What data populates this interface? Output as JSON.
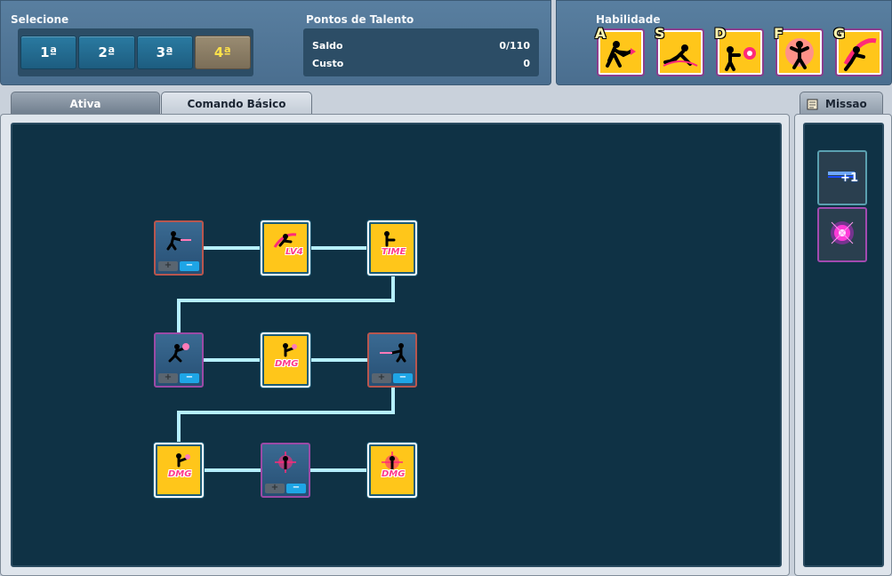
{
  "header": {
    "select_label": "Selecione",
    "select_buttons": [
      {
        "label": "1ª",
        "active": false
      },
      {
        "label": "2ª",
        "active": false
      },
      {
        "label": "3ª",
        "active": false
      },
      {
        "label": "4ª",
        "active": true
      }
    ],
    "talent_title": "Pontos de Talento",
    "saldo_label": "Saldo",
    "saldo_value": "0/110",
    "custo_label": "Custo",
    "custo_value": "0",
    "skills_title": "Habilidade",
    "skills": [
      {
        "key": "A",
        "icon": "kick-skill-icon"
      },
      {
        "key": "S",
        "icon": "slide-skill-icon"
      },
      {
        "key": "D",
        "icon": "energy-blast-skill-icon"
      },
      {
        "key": "F",
        "icon": "burst-skill-icon"
      },
      {
        "key": "G",
        "icon": "dash-strike-skill-icon"
      }
    ]
  },
  "tabs": {
    "ativa": "Ativa",
    "comando": "Comando Básico",
    "missao": "Missao"
  },
  "tree": {
    "rows": [
      {
        "nodes": [
          {
            "style": "blue",
            "tag": "",
            "icon": "shoot-skill-icon",
            "controls": true
          },
          {
            "style": "gold",
            "tag": "LV4",
            "icon": "leap-skill-icon",
            "controls": false
          },
          {
            "style": "gold",
            "tag": "TIME",
            "icon": "time-skill-icon",
            "controls": false
          }
        ]
      },
      {
        "nodes": [
          {
            "style": "blue-purple",
            "tag": "",
            "icon": "spin-skill-icon",
            "controls": true
          },
          {
            "style": "gold",
            "tag": "DMG",
            "icon": "damage-skill-icon",
            "controls": false
          },
          {
            "style": "blue",
            "tag": "",
            "icon": "blast-skill-icon",
            "controls": true
          }
        ]
      },
      {
        "nodes": [
          {
            "style": "gold",
            "tag": "DMG",
            "icon": "damage-skill-icon",
            "controls": false
          },
          {
            "style": "blue-purple",
            "tag": "",
            "icon": "target-skill-icon",
            "controls": true
          },
          {
            "style": "gold",
            "tag": "DMG",
            "icon": "target-damage-skill-icon",
            "controls": false
          }
        ]
      }
    ],
    "plus_symbol": "+",
    "minus_symbol": "−"
  },
  "sidebar": {
    "items": [
      {
        "icon": "ammo-plus-icon",
        "text": "+1"
      },
      {
        "icon": "magic-orb-icon",
        "text": ""
      }
    ]
  },
  "colors": {
    "panel_bg": "#0f3245",
    "header_bg": "#4a6e8f",
    "connector": "#b6f0ff",
    "gold": "#ffc61a",
    "active_button_text": "#ffe24a"
  }
}
